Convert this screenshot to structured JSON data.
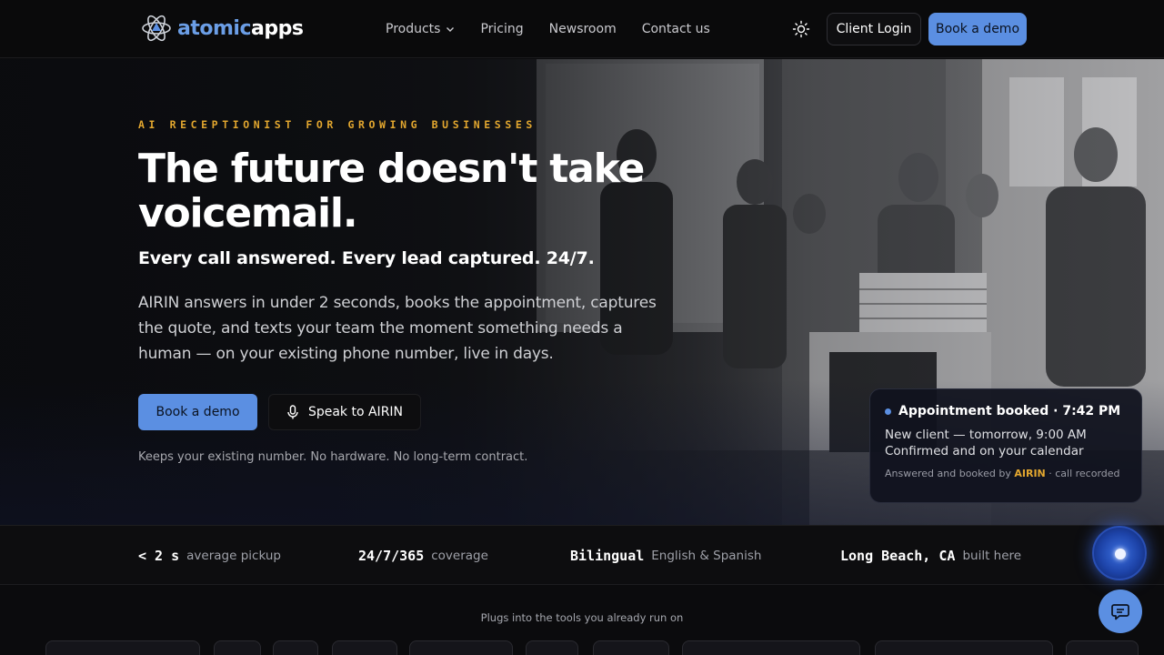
{
  "brand": {
    "name_part1": "atomic",
    "name_part2": "apps",
    "accent": "#5b8fe2",
    "gold": "#e3a72f"
  },
  "nav": {
    "links": [
      {
        "label": "Products",
        "has_dropdown": true
      },
      {
        "label": "Pricing"
      },
      {
        "label": "Newsroom"
      },
      {
        "label": "Contact us"
      }
    ],
    "theme_toggle_icon": "sun-icon",
    "login_label": "Client Login",
    "demo_label": "Book a demo"
  },
  "hero": {
    "eyebrow": "AI RECEPTIONIST FOR GROWING BUSINESSES",
    "headline_line1": "The future doesn't take",
    "headline_line2": "voicemail.",
    "subhead": "Every call answered. Every lead captured. 24/7.",
    "body": "AIRIN answers in under 2 seconds, books the appointment, captures the quote, and texts your team the moment something needs a human — on your existing phone number, live in days.",
    "primary_cta": "Book a demo",
    "secondary_cta": "Speak to AIRIN",
    "secondary_icon": "microphone-icon",
    "fineprint": "Keeps your existing number. No hardware. No long-term contract."
  },
  "toast": {
    "title": "Appointment booked · 7:42 PM",
    "line1": "New client — tomorrow, 9:00 AM",
    "line2": "Confirmed and on your calendar",
    "foot_prefix": "Answered and booked by ",
    "foot_brand": "AIRIN",
    "foot_suffix": " · call recorded"
  },
  "stats": [
    {
      "value": "< 2 s",
      "label": "average pickup"
    },
    {
      "value": "24/7/365",
      "label": "coverage"
    },
    {
      "value": "Bilingual",
      "label": "English & Spanish"
    },
    {
      "value": "Long Beach, CA",
      "label": "built here"
    }
  ],
  "integrations": {
    "heading": "Plugs into the tools you already run on"
  },
  "widgets": {
    "voice_orb_icon": "voice-orb-icon",
    "chat_icon": "chat-icon"
  }
}
